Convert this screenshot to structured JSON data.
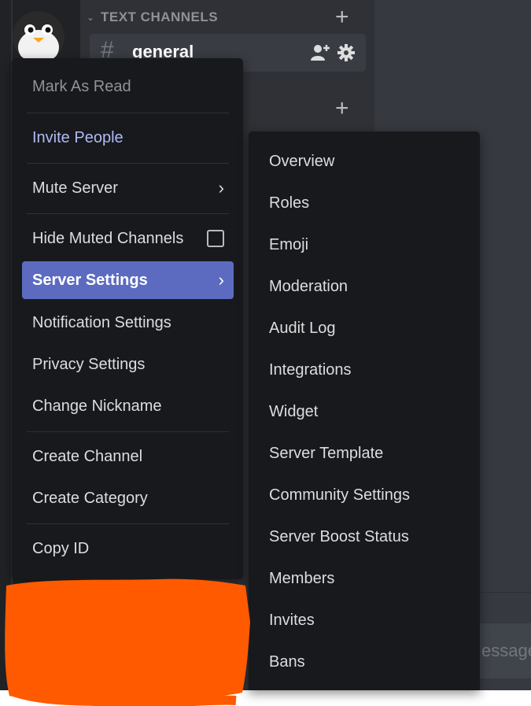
{
  "channels": {
    "category_label": "TEXT CHANNELS",
    "general_channel": "general"
  },
  "message_input": {
    "placeholder_fragment": "essage"
  },
  "context_menu": {
    "mark_as_read": "Mark As Read",
    "invite_people": "Invite People",
    "mute_server": "Mute Server",
    "hide_muted_channels": "Hide Muted Channels",
    "hide_muted_checked": false,
    "server_settings": "Server Settings",
    "notification_settings": "Notification Settings",
    "privacy_settings": "Privacy Settings",
    "change_nickname": "Change Nickname",
    "create_channel": "Create Channel",
    "create_category": "Create Category",
    "copy_id": "Copy ID"
  },
  "server_settings_submenu": [
    "Overview",
    "Roles",
    "Emoji",
    "Moderation",
    "Audit Log",
    "Integrations",
    "Widget",
    "Server Template",
    "Community Settings",
    "Server Boost Status",
    "Members",
    "Invites",
    "Bans"
  ],
  "icons": {
    "category_toggle": "chevron-down-icon",
    "add_channel": "plus-icon",
    "invite_user": "add-user-icon",
    "channel_settings": "gear-icon",
    "submenu_arrow": "chevron-right-icon",
    "channel_type": "hash-icon"
  },
  "colors": {
    "server_rail": "#202225",
    "channel_sidebar": "#2f3136",
    "main_area": "#36393f",
    "menu_background": "#18191c",
    "active_item": "#5c6bc0",
    "invite_text": "#b1baf5",
    "redaction_scribble": "#ff5a00"
  }
}
